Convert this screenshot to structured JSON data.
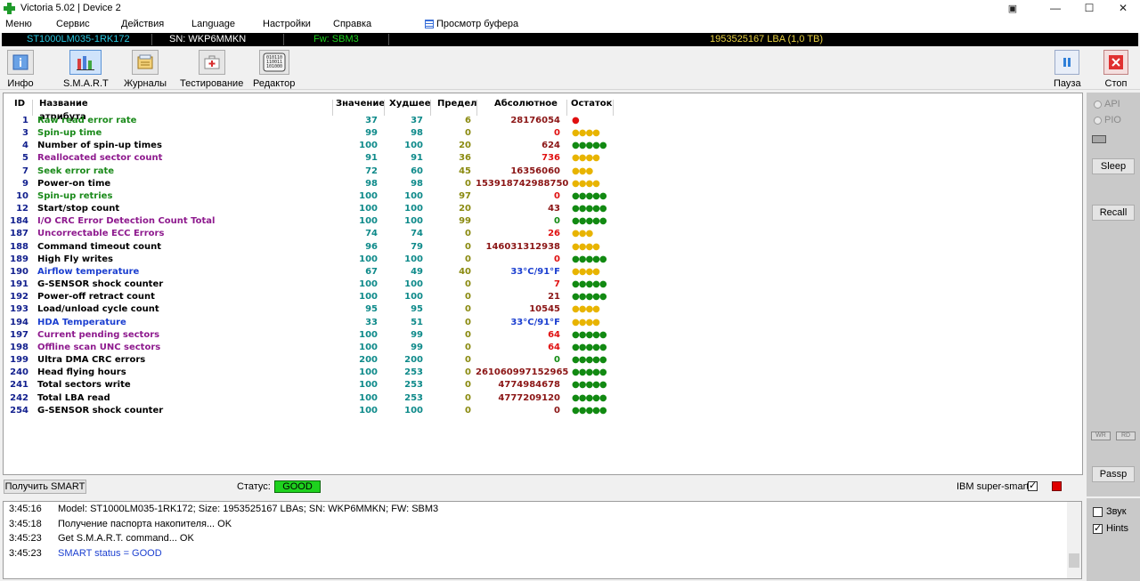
{
  "window": {
    "title": "Victoria 5.02 | Device 2",
    "restore_label": "⧉",
    "min_label": "—",
    "max_label": "☐",
    "close_label": "✕",
    "extra_label": "▣"
  },
  "menu": {
    "items": [
      "Меню",
      "Сервис",
      "Действия",
      "Language",
      "Настройки",
      "Справка"
    ],
    "buffer_label": "Просмотр буфера"
  },
  "infobar": {
    "model": "ST1000LM035-1RK172",
    "serial": "SN: WKP6MMKN",
    "firmware": "Fw: SBM3",
    "capacity": "1953525167 LBA (1,0 TB)"
  },
  "toolbar": {
    "buttons": [
      {
        "label": "Инфо",
        "icon": "info-icon"
      },
      {
        "label": "S.M.A.R.T",
        "icon": "smart-chart-icon"
      },
      {
        "label": "Журналы",
        "icon": "journals-icon"
      },
      {
        "label": "Тестирование",
        "icon": "first-aid-kit-icon"
      },
      {
        "label": "Редактор",
        "icon": "binary-editor-icon"
      }
    ],
    "pause_label": "Пауза",
    "stop_label": "Стоп"
  },
  "table": {
    "headers": [
      "ID",
      "Название атрибута",
      "Значение",
      "Худшее",
      "Предел",
      "Абсолютное",
      "Остаток"
    ],
    "rows": [
      {
        "id": "1",
        "name": "Raw read error rate",
        "value": "37",
        "worst": "37",
        "threshold": "6",
        "raw": "28176054",
        "remain": "●",
        "name_color": "#1a8a1a",
        "raw_color": "#8b1515",
        "remain_color": "#e01010"
      },
      {
        "id": "3",
        "name": "Spin-up time",
        "value": "99",
        "worst": "98",
        "threshold": "0",
        "raw": "0",
        "remain": "●●●●",
        "name_color": "#1a8a1a",
        "raw_color": "#e01010",
        "remain_color": "#e8b400"
      },
      {
        "id": "4",
        "name": "Number of spin-up times",
        "value": "100",
        "worst": "100",
        "threshold": "20",
        "raw": "624",
        "remain": "●●●●●",
        "name_color": "#000000",
        "raw_color": "#8b1515",
        "remain_color": "#128a12"
      },
      {
        "id": "5",
        "name": "Reallocated sector count",
        "value": "91",
        "worst": "91",
        "threshold": "36",
        "raw": "736",
        "remain": "●●●●",
        "name_color": "#8e1a8e",
        "raw_color": "#e01010",
        "remain_color": "#e8b400"
      },
      {
        "id": "7",
        "name": "Seek error rate",
        "value": "72",
        "worst": "60",
        "threshold": "45",
        "raw": "16356060",
        "remain": "●●●",
        "name_color": "#1a8a1a",
        "raw_color": "#8b1515",
        "remain_color": "#e8b400"
      },
      {
        "id": "9",
        "name": "Power-on time",
        "value": "98",
        "worst": "98",
        "threshold": "0",
        "raw": "153918742988750",
        "remain": "●●●●",
        "name_color": "#000000",
        "raw_color": "#8b1515",
        "remain_color": "#e8b400"
      },
      {
        "id": "10",
        "name": "Spin-up retries",
        "value": "100",
        "worst": "100",
        "threshold": "97",
        "raw": "0",
        "remain": "●●●●●",
        "name_color": "#1a8a1a",
        "raw_color": "#e01010",
        "remain_color": "#128a12"
      },
      {
        "id": "12",
        "name": "Start/stop count",
        "value": "100",
        "worst": "100",
        "threshold": "20",
        "raw": "43",
        "remain": "●●●●●",
        "name_color": "#000000",
        "raw_color": "#8b1515",
        "remain_color": "#128a12"
      },
      {
        "id": "184",
        "name": "I/O CRC Error Detection Count Total",
        "value": "100",
        "worst": "100",
        "threshold": "99",
        "raw": "0",
        "remain": "●●●●●",
        "name_color": "#8e1a8e",
        "raw_color": "#128a12",
        "remain_color": "#128a12"
      },
      {
        "id": "187",
        "name": "Uncorrectable ECC Errors",
        "value": "74",
        "worst": "74",
        "threshold": "0",
        "raw": "26",
        "remain": "●●●",
        "name_color": "#8e1a8e",
        "raw_color": "#e01010",
        "remain_color": "#e8b400"
      },
      {
        "id": "188",
        "name": "Command timeout count",
        "value": "96",
        "worst": "79",
        "threshold": "0",
        "raw": "146031312938",
        "remain": "●●●●",
        "name_color": "#000000",
        "raw_color": "#8b1515",
        "remain_color": "#e8b400"
      },
      {
        "id": "189",
        "name": "High Fly writes",
        "value": "100",
        "worst": "100",
        "threshold": "0",
        "raw": "0",
        "remain": "●●●●●",
        "name_color": "#000000",
        "raw_color": "#e01010",
        "remain_color": "#128a12"
      },
      {
        "id": "190",
        "name": "Airflow temperature",
        "value": "67",
        "worst": "49",
        "threshold": "40",
        "raw": "33°C/91°F",
        "remain": "●●●●",
        "name_color": "#1b3fd0",
        "raw_color": "#1b3fd0",
        "remain_color": "#e8b400"
      },
      {
        "id": "191",
        "name": "G-SENSOR shock counter",
        "value": "100",
        "worst": "100",
        "threshold": "0",
        "raw": "7",
        "remain": "●●●●●",
        "name_color": "#000000",
        "raw_color": "#e01010",
        "remain_color": "#128a12"
      },
      {
        "id": "192",
        "name": "Power-off retract count",
        "value": "100",
        "worst": "100",
        "threshold": "0",
        "raw": "21",
        "remain": "●●●●●",
        "name_color": "#000000",
        "raw_color": "#8b1515",
        "remain_color": "#128a12"
      },
      {
        "id": "193",
        "name": "Load/unload cycle count",
        "value": "95",
        "worst": "95",
        "threshold": "0",
        "raw": "10545",
        "remain": "●●●●",
        "name_color": "#000000",
        "raw_color": "#8b1515",
        "remain_color": "#e8b400"
      },
      {
        "id": "194",
        "name": "HDA Temperature",
        "value": "33",
        "worst": "51",
        "threshold": "0",
        "raw": "33°C/91°F",
        "remain": "●●●●",
        "name_color": "#1b3fd0",
        "raw_color": "#1b3fd0",
        "remain_color": "#e8b400"
      },
      {
        "id": "197",
        "name": "Current pending sectors",
        "value": "100",
        "worst": "99",
        "threshold": "0",
        "raw": "64",
        "remain": "●●●●●",
        "name_color": "#8e1a8e",
        "raw_color": "#e01010",
        "remain_color": "#128a12"
      },
      {
        "id": "198",
        "name": "Offline scan UNC sectors",
        "value": "100",
        "worst": "99",
        "threshold": "0",
        "raw": "64",
        "remain": "●●●●●",
        "name_color": "#8e1a8e",
        "raw_color": "#e01010",
        "remain_color": "#128a12"
      },
      {
        "id": "199",
        "name": "Ultra DMA CRC errors",
        "value": "200",
        "worst": "200",
        "threshold": "0",
        "raw": "0",
        "remain": "●●●●●",
        "name_color": "#000000",
        "raw_color": "#128a12",
        "remain_color": "#128a12"
      },
      {
        "id": "240",
        "name": "Head flying hours",
        "value": "100",
        "worst": "253",
        "threshold": "0",
        "raw": "261060997152965",
        "remain": "●●●●●",
        "name_color": "#000000",
        "raw_color": "#8b1515",
        "remain_color": "#128a12"
      },
      {
        "id": "241",
        "name": "Total sectors write",
        "value": "100",
        "worst": "253",
        "threshold": "0",
        "raw": "4774984678",
        "remain": "●●●●●",
        "name_color": "#000000",
        "raw_color": "#8b1515",
        "remain_color": "#128a12"
      },
      {
        "id": "242",
        "name": "Total LBA read",
        "value": "100",
        "worst": "253",
        "threshold": "0",
        "raw": "4777209120",
        "remain": "●●●●●",
        "name_color": "#000000",
        "raw_color": "#8b1515",
        "remain_color": "#128a12"
      },
      {
        "id": "254",
        "name": "G-SENSOR shock counter",
        "value": "100",
        "worst": "100",
        "threshold": "0",
        "raw": "0",
        "remain": "●●●●●",
        "name_color": "#000000",
        "raw_color": "#8b1515",
        "remain_color": "#128a12"
      }
    ]
  },
  "statusbar": {
    "get_smart_label": "Получить SMART",
    "status_label": "Статус:",
    "status_value": "GOOD",
    "ibm_label": "IBM super-smart:"
  },
  "right_panel": {
    "api_label": "API",
    "pio_label": "PIO",
    "sleep_label": "Sleep",
    "recall_label": "Recall",
    "wr_label": "WR",
    "rd_label": "RD",
    "passp_label": "Passp"
  },
  "log": {
    "lines": [
      {
        "time": "3:45:16",
        "text": "Model: ST1000LM035-1RK172; Size: 1953525167 LBAs; SN: WKP6MMKN; FW: SBM3",
        "color": "#000000"
      },
      {
        "time": "3:45:18",
        "text": "Получение паспорта накопителя... OK",
        "color": "#000000"
      },
      {
        "time": "3:45:23",
        "text": "Get S.M.A.R.T. command... OK",
        "color": "#000000"
      },
      {
        "time": "3:45:23",
        "text": "SMART status = GOOD",
        "color": "#1b3fd0"
      }
    ]
  },
  "options": {
    "sound_label": "Звук",
    "hints_label": "Hints"
  },
  "colors": {
    "good": "#1ed21e",
    "stop": "#e03030",
    "pause": "#2f7fd8",
    "indicator": "#e00000"
  }
}
